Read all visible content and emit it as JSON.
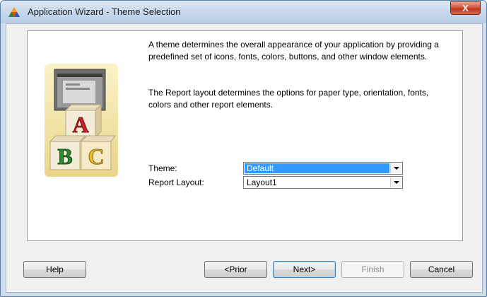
{
  "window": {
    "title": "Application Wizard - Theme Selection",
    "close_glyph": "X"
  },
  "content": {
    "paragraph1": "A theme determines the overall appearance of your application by providing a predefined set of icons, fonts, colors, buttons, and other window elements.",
    "paragraph2": "The Report layout determines the options for paper type, orientation, fonts, colors and other report elements."
  },
  "illustration": {
    "block_letters": [
      "A",
      "B",
      "C"
    ]
  },
  "fields": {
    "theme_label": "Theme:",
    "theme_value": "Default",
    "report_layout_label": "Report Layout:",
    "report_layout_value": "Layout1"
  },
  "buttons": {
    "help": "Help",
    "prior": "<Prior",
    "next": "Next>",
    "finish": "Finish",
    "cancel": "Cancel"
  },
  "colors": {
    "selection": "#3399ff",
    "title_bar": "#c7d8ec",
    "close_button": "#c0351c"
  }
}
